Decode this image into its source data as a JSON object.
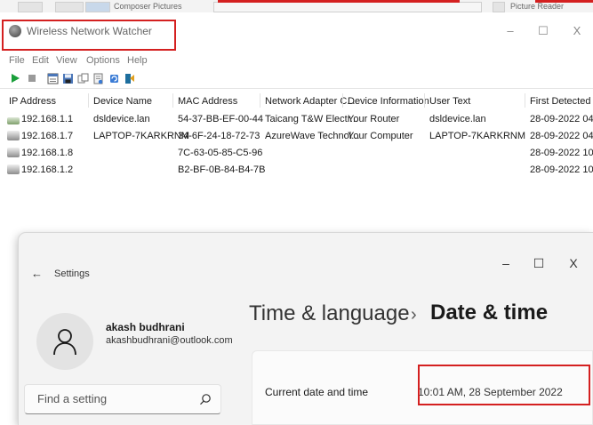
{
  "background_window": {
    "tab_text_1": "Composer Pictures",
    "tab_text_2": "Picture Reader"
  },
  "wnw": {
    "title": "Wireless Network Watcher",
    "menu": [
      "File",
      "Edit",
      "View",
      "Options",
      "Help"
    ],
    "caption": {
      "minimize": "–",
      "maximize": "☐",
      "close": "X"
    },
    "columns": [
      "IP Address",
      "Device Name",
      "MAC Address",
      "Network Adapter C...",
      "Device Information",
      "User Text",
      "First Detected ..."
    ],
    "rows": [
      {
        "ip": "192.168.1.1",
        "device": "dsldevice.lan",
        "mac": "54-37-BB-EF-00-44",
        "adapter": "Taicang T&W Electr...",
        "info": "Your Router",
        "user_text": "dsldevice.lan",
        "first": "28-09-2022 04:..",
        "icon": "router-icon"
      },
      {
        "ip": "192.168.1.7",
        "device": "LAPTOP-7KARKRNM",
        "mac": "34-6F-24-18-72-73",
        "adapter": "AzureWave Technol...",
        "info": "Your Computer",
        "user_text": "LAPTOP-7KARKRNM",
        "first": "28-09-2022 04:..",
        "icon": "computer-icon"
      },
      {
        "ip": "192.168.1.8",
        "device": "",
        "mac": "7C-63-05-85-C5-96",
        "adapter": "",
        "info": "",
        "user_text": "",
        "first": "28-09-2022 10:..",
        "icon": "computer-icon"
      },
      {
        "ip": "192.168.1.2",
        "device": "",
        "mac": "B2-BF-0B-84-B4-7B",
        "adapter": "",
        "info": "",
        "user_text": "",
        "first": "28-09-2022 10:..",
        "icon": "computer-icon"
      }
    ]
  },
  "settings": {
    "back_glyph": "←",
    "app_title": "Settings",
    "caption": {
      "minimize": "–",
      "maximize": "☐",
      "close": "X"
    },
    "user": {
      "name": "akash budhrani",
      "email": "akashbudhrani@outlook.com"
    },
    "search": {
      "placeholder": "Find a setting"
    },
    "breadcrumb": {
      "parent": "Time & language",
      "separator": "›",
      "current": "Date & time"
    },
    "date_card": {
      "label": "Current date and time",
      "value": "10:01 AM, 28 September 2022"
    }
  },
  "colors": {
    "highlight_red": "#d42020",
    "play_green": "#1a9f3a"
  }
}
